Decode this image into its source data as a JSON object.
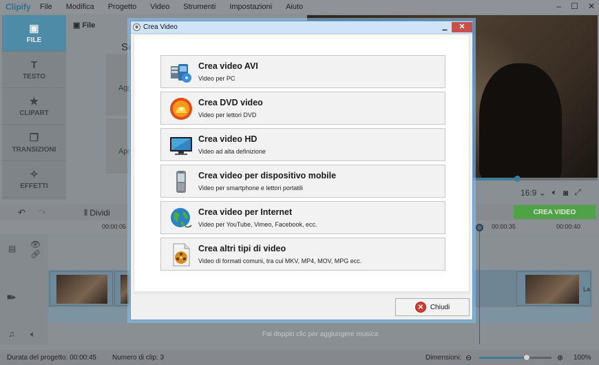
{
  "app": {
    "logo": "Clipify",
    "menu": [
      "File",
      "Modifica",
      "Progetto",
      "Video",
      "Strumenti",
      "Impostazioni",
      "Aiuto"
    ],
    "window_controls": [
      "–",
      "☐",
      "✕"
    ]
  },
  "sidebar": {
    "items": [
      {
        "label": "FILE",
        "icon": "image-icon"
      },
      {
        "label": "TESTO",
        "icon": "text-t-icon"
      },
      {
        "label": "CLIPART",
        "icon": "star-icon"
      },
      {
        "label": "TRANSIZIONI",
        "icon": "transitions-icon"
      },
      {
        "label": "EFFETTI",
        "icon": "magic-wand-icon"
      }
    ]
  },
  "file_panel": {
    "tab_label": "File",
    "title_fragment": "Se",
    "add_fragment_1": "Agg",
    "add_fragment_2": "Apr"
  },
  "player": {
    "aspect_ratio": "16:9",
    "progress": 0.725
  },
  "toolbar": {
    "split_label": "Dividi",
    "create_video_label": "CREA VIDEO"
  },
  "timeline": {
    "ticks": [
      "00:00:05",
      "00:00:35",
      "00:00:40"
    ],
    "music_placeholder": "Fai doppio clic per aggiungere musica",
    "clip_label_fragment": "La"
  },
  "status": {
    "duration": "Durata del progetto: 00:00:45",
    "clip_count": "Numero di clip: 3",
    "dimensions_label": "Dimensioni:",
    "zoom": "100%"
  },
  "dialog": {
    "title": "Crea Video",
    "close_label": "Chiudi",
    "options": [
      {
        "title": "Crea video AVI",
        "subtitle": "Video per PC",
        "icon": "avi-film-icon"
      },
      {
        "title": "Crea DVD video",
        "subtitle": "Video per lettori DVD",
        "icon": "dvd-disc-icon"
      },
      {
        "title": "Crea video HD",
        "subtitle": "Video ad alta definizione",
        "icon": "hd-monitor-icon"
      },
      {
        "title": "Crea video per dispositivo mobile",
        "subtitle": "Video per smartphone e lettori portatili",
        "icon": "mobile-phone-icon"
      },
      {
        "title": "Crea video per Internet",
        "subtitle": "Video per YouTube, Vimeo, Facebook, ecc.",
        "icon": "globe-icon"
      },
      {
        "title": "Crea altri tipi di video",
        "subtitle": "Video di formati comuni, tra cui MKV, MP4, MOV, MPG ecc.",
        "icon": "film-document-icon"
      }
    ]
  }
}
